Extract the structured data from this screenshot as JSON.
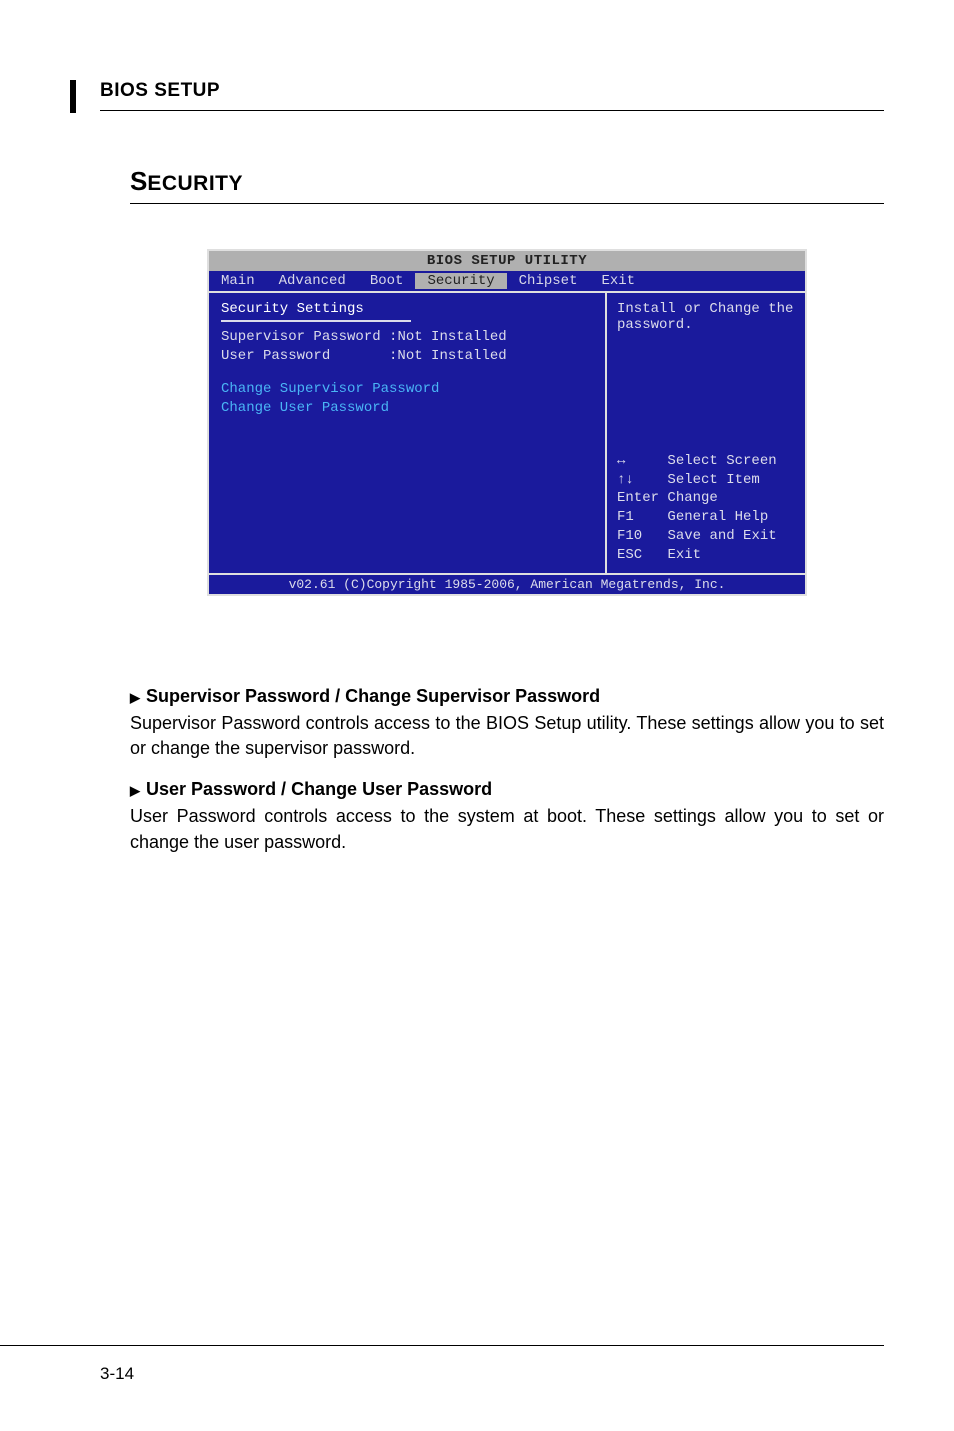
{
  "header": {
    "title": "BIOS SETUP"
  },
  "section": {
    "prefix": "S",
    "title": "ECURITY"
  },
  "bios": {
    "title": "BIOS SETUP UTILITY",
    "tabs": [
      "Main",
      "Advanced",
      "Boot",
      "Security",
      "Chipset",
      "Exit"
    ],
    "active_tab_index": 3,
    "left": {
      "heading": "Security Settings",
      "rows": [
        {
          "label": "Supervisor Password",
          "value": ":Not Installed"
        },
        {
          "label": "User Password",
          "value": ":Not Installed"
        }
      ],
      "options": [
        "Change Supervisor Password",
        "Change User Password"
      ]
    },
    "right": {
      "help": "Install or Change the password.",
      "keys": [
        {
          "key": "↔",
          "action": "Select Screen"
        },
        {
          "key": "↑↓",
          "action": "Select Item"
        },
        {
          "key": "Enter",
          "action": "Change"
        },
        {
          "key": "F1",
          "action": "General Help"
        },
        {
          "key": "F10",
          "action": "Save and Exit"
        },
        {
          "key": "ESC",
          "action": "Exit"
        }
      ]
    },
    "footer": "v02.61 (C)Copyright 1985-2006, American Megatrends, Inc."
  },
  "body": {
    "items": [
      {
        "heading": "Supervisor Password / Change Supervisor Password",
        "desc": "Supervisor Password controls access to the BIOS Setup utility. These settings allow you to set or change the supervisor password."
      },
      {
        "heading": "User Password / Change User Password",
        "desc": "User Password controls access to the system at boot. These settings allow you to set or change the user password."
      }
    ]
  },
  "page_number": "3-14"
}
